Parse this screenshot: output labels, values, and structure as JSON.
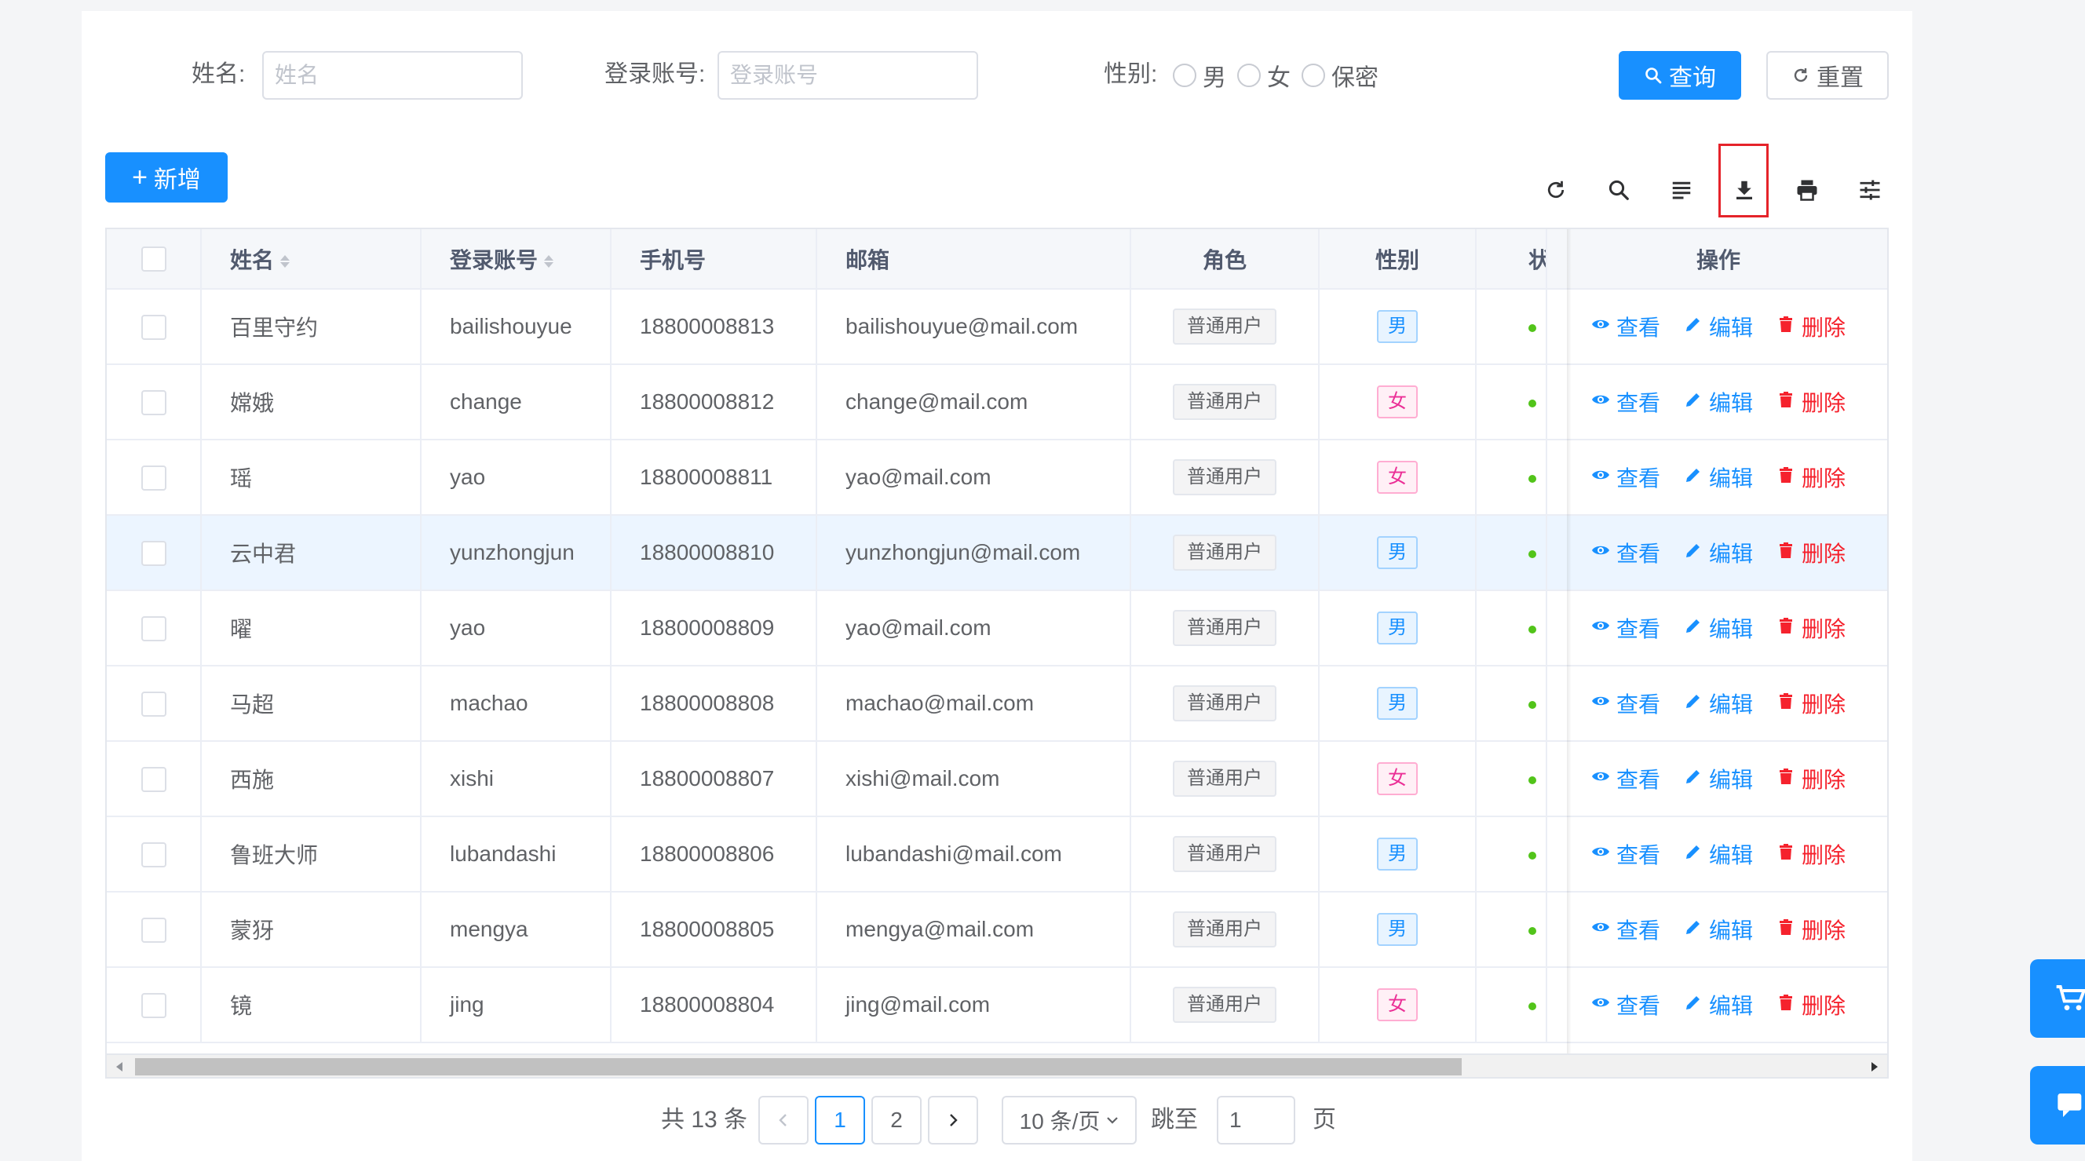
{
  "search": {
    "name_label": "姓名:",
    "name_placeholder": "姓名",
    "account_label": "登录账号:",
    "account_placeholder": "登录账号",
    "gender_label": "性别:",
    "gender_options": [
      "男",
      "女",
      "保密"
    ],
    "query_label": "查询",
    "reset_label": "重置"
  },
  "toolbar": {
    "add_label": "新增",
    "icons": [
      "refresh-icon",
      "search-icon",
      "lines-icon",
      "download-icon",
      "print-icon",
      "column-settings-icon"
    ]
  },
  "table": {
    "columns": [
      "姓名",
      "登录账号",
      "手机号",
      "邮箱",
      "角色",
      "性别",
      "状",
      "操作"
    ],
    "rows": [
      {
        "name": "百里守约",
        "account": "bailishouyue",
        "phone": "18800008813",
        "email": "bailishouyue@mail.com",
        "role": "普通用户",
        "gender": "男"
      },
      {
        "name": "嫦娥",
        "account": "change",
        "phone": "18800008812",
        "email": "change@mail.com",
        "role": "普通用户",
        "gender": "女"
      },
      {
        "name": "瑶",
        "account": "yao",
        "phone": "18800008811",
        "email": "yao@mail.com",
        "role": "普通用户",
        "gender": "女"
      },
      {
        "name": "云中君",
        "account": "yunzhongjun",
        "phone": "18800008810",
        "email": "yunzhongjun@mail.com",
        "role": "普通用户",
        "gender": "男"
      },
      {
        "name": "曜",
        "account": "yao",
        "phone": "18800008809",
        "email": "yao@mail.com",
        "role": "普通用户",
        "gender": "男"
      },
      {
        "name": "马超",
        "account": "machao",
        "phone": "18800008808",
        "email": "machao@mail.com",
        "role": "普通用户",
        "gender": "男"
      },
      {
        "name": "西施",
        "account": "xishi",
        "phone": "18800008807",
        "email": "xishi@mail.com",
        "role": "普通用户",
        "gender": "女"
      },
      {
        "name": "鲁班大师",
        "account": "lubandashi",
        "phone": "18800008806",
        "email": "lubandashi@mail.com",
        "role": "普通用户",
        "gender": "男"
      },
      {
        "name": "蒙犽",
        "account": "mengya",
        "phone": "18800008805",
        "email": "mengya@mail.com",
        "role": "普通用户",
        "gender": "男"
      },
      {
        "name": "镜",
        "account": "jing",
        "phone": "18800008804",
        "email": "jing@mail.com",
        "role": "普通用户",
        "gender": "女"
      }
    ],
    "actions": {
      "view": "查看",
      "edit": "编辑",
      "delete": "删除"
    }
  },
  "pagination": {
    "total_label": "共 13 条",
    "pages": [
      "1",
      "2"
    ],
    "current_page": "1",
    "page_size_label": "10 条/页",
    "jump_label": "跳至",
    "jump_value": "1",
    "page_suffix": "页"
  },
  "colors": {
    "primary": "#1890ff",
    "danger": "#f5222d",
    "success": "#52c41a",
    "highlight_box": "#e5232a"
  }
}
